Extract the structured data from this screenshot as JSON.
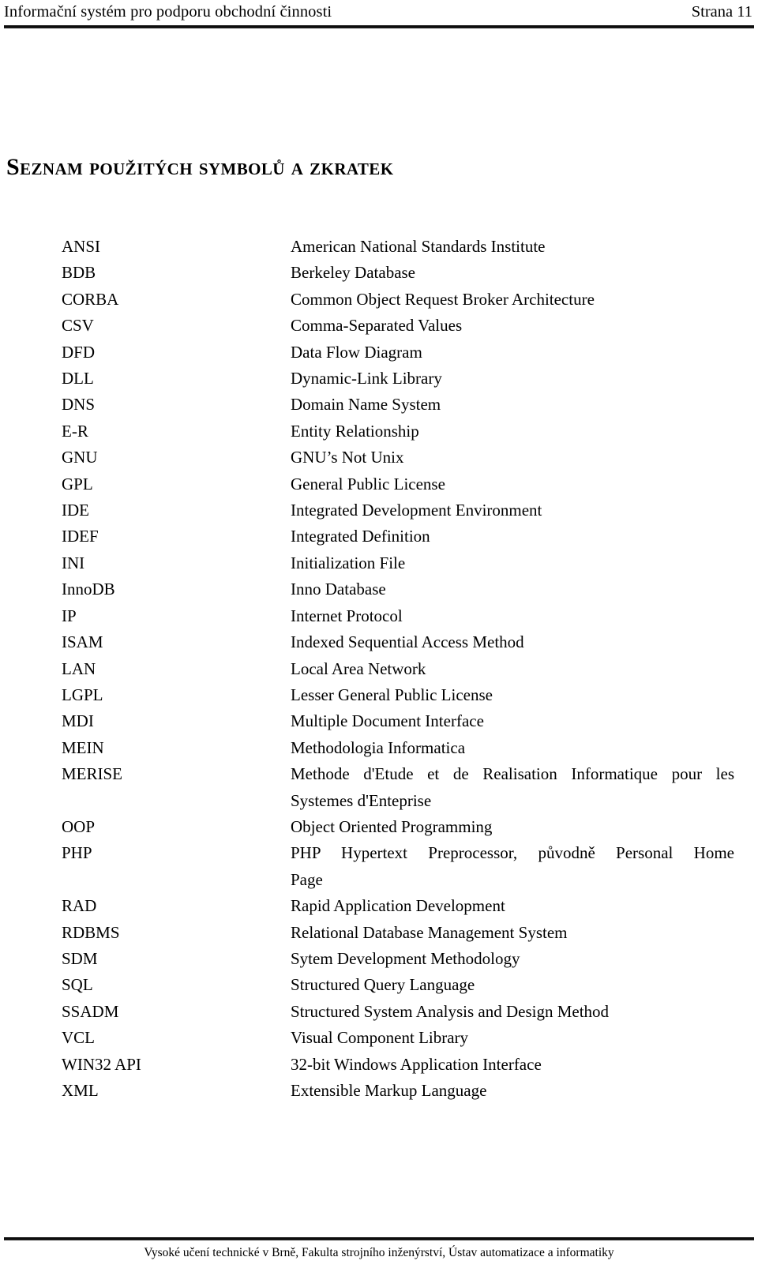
{
  "header": {
    "document_title": "Informační systém pro podporu obchodní činnosti",
    "page_label": "Strana 11"
  },
  "heading": {
    "text": "Seznam použitých symbolů a zkratek"
  },
  "abbreviations": [
    {
      "term": "ANSI",
      "definition": "American National Standards Institute"
    },
    {
      "term": "BDB",
      "definition": "Berkeley Database"
    },
    {
      "term": "CORBA",
      "definition": "Common Object Request Broker Architecture"
    },
    {
      "term": "CSV",
      "definition": "Comma-Separated Values"
    },
    {
      "term": "DFD",
      "definition": "Data Flow Diagram"
    },
    {
      "term": "DLL",
      "definition": "Dynamic-Link Library"
    },
    {
      "term": "DNS",
      "definition": "Domain Name System"
    },
    {
      "term": "E-R",
      "definition": "Entity Relationship"
    },
    {
      "term": "GNU",
      "definition": "GNU’s Not Unix"
    },
    {
      "term": "GPL",
      "definition": "General Public License"
    },
    {
      "term": "IDE",
      "definition": "Integrated Development Environment"
    },
    {
      "term": "IDEF",
      "definition": "Integrated Definition"
    },
    {
      "term": "INI",
      "definition": "Initialization File"
    },
    {
      "term": "InnoDB",
      "definition": "Inno Database"
    },
    {
      "term": "IP",
      "definition": "Internet Protocol"
    },
    {
      "term": "ISAM",
      "definition": "Indexed Sequential Access Method"
    },
    {
      "term": "LAN",
      "definition": "Local Area Network"
    },
    {
      "term": "LGPL",
      "definition": "Lesser General Public License"
    },
    {
      "term": "MDI",
      "definition": "Multiple Document Interface"
    },
    {
      "term": "MEIN",
      "definition": "Methodologia Informatica"
    },
    {
      "term": "MERISE",
      "definition": "Methode d'Etude et de Realisation Informatique pour les Systemes d'Enteprise",
      "line1": "Methode d'Etude et de Realisation Informatique pour les",
      "line2": "Systemes d'Enteprise"
    },
    {
      "term": "OOP",
      "definition": "Object Oriented Programming"
    },
    {
      "term": "PHP",
      "definition": "PHP Hypertext Preprocessor, původně Personal Home Page",
      "line1": "PHP Hypertext Preprocessor, původně Personal Home",
      "line2": "Page"
    },
    {
      "term": "RAD",
      "definition": "Rapid Application Development"
    },
    {
      "term": "RDBMS",
      "definition": "Relational Database Management System"
    },
    {
      "term": "SDM",
      "definition": "Sytem Development Methodology"
    },
    {
      "term": "SQL",
      "definition": "Structured Query Language"
    },
    {
      "term": "SSADM",
      "definition": "Structured System Analysis and Design Method"
    },
    {
      "term": "VCL",
      "definition": "Visual Component Library"
    },
    {
      "term": "WIN32 API",
      "definition": "32-bit Windows Application Interface"
    },
    {
      "term": "XML",
      "definition": "Extensible Markup Language"
    }
  ],
  "footer": {
    "text": "Vysoké učení technické v Brně, Fakulta strojního inženýrství, Ústav automatizace a informatiky"
  },
  "colors": {
    "text": "#000000",
    "rule": "#0d0d0d",
    "background": "#ffffff"
  }
}
